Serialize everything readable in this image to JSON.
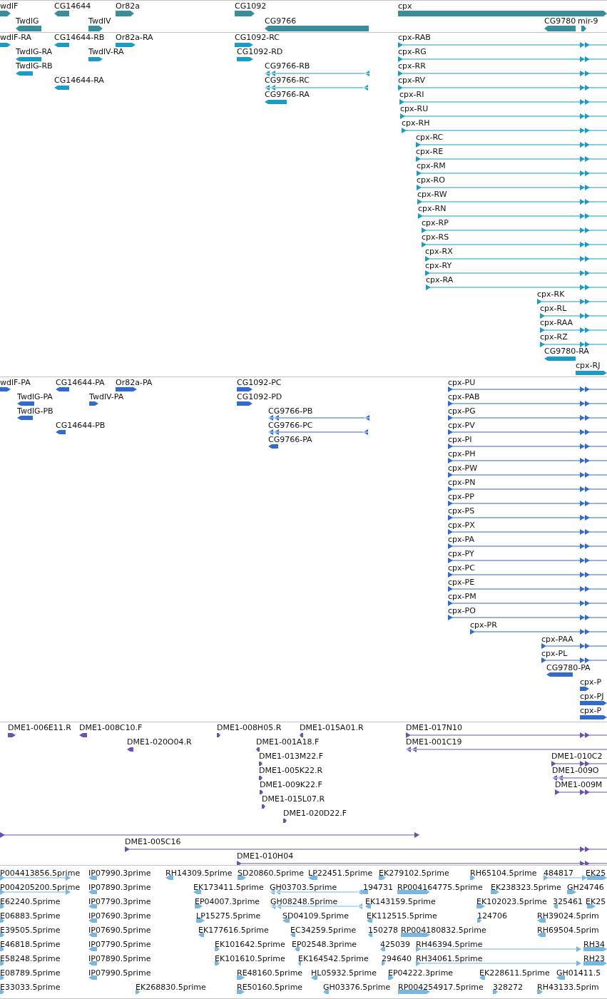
{
  "tracks": [
    {
      "kind": "gene",
      "color": "#3a8e9c",
      "features": [
        {
          "label": "wdlF",
          "forward": true
        },
        {
          "label": "CG14644",
          "forward": false
        },
        {
          "label": "Or82a",
          "forward": true
        },
        {
          "label": "CG1092",
          "forward": true
        },
        {
          "label": "cpx",
          "forward": true
        },
        {
          "label": "TwdlG",
          "forward": false
        },
        {
          "label": "TwdlV",
          "forward": true
        },
        {
          "label": "CG9766",
          "forward": false
        },
        {
          "label": "CG9780",
          "forward": false
        },
        {
          "label": "mir-9",
          "forward": true
        }
      ]
    },
    {
      "kind": "transcript",
      "color": "#1a9cc4",
      "features": [
        {
          "label": "wdlF-RA",
          "forward": true
        },
        {
          "label": "CG14644-RB",
          "forward": false
        },
        {
          "label": "Or82a-RA",
          "forward": true
        },
        {
          "label": "CG1092-RC",
          "forward": true
        },
        {
          "label": "cpx-RAB",
          "forward": true
        },
        {
          "label": "TwdlG-RA",
          "forward": false
        },
        {
          "label": "TwdlV-RA",
          "forward": true
        },
        {
          "label": "CG1092-RD",
          "forward": true
        },
        {
          "label": "cpx-RG",
          "forward": true
        },
        {
          "label": "TwdlG-RB",
          "forward": false
        },
        {
          "label": "CG9766-RB",
          "forward": false
        },
        {
          "label": "cpx-RR",
          "forward": true
        },
        {
          "label": "CG14644-RA",
          "forward": false
        },
        {
          "label": "CG9766-RC",
          "forward": false
        },
        {
          "label": "cpx-RV",
          "forward": true
        },
        {
          "label": "CG9766-RA",
          "forward": false
        },
        {
          "label": "cpx-RI",
          "forward": true
        },
        {
          "label": "cpx-RU",
          "forward": true
        },
        {
          "label": "cpx-RH",
          "forward": true
        },
        {
          "label": "cpx-RC",
          "forward": true
        },
        {
          "label": "cpx-RE",
          "forward": true
        },
        {
          "label": "cpx-RM",
          "forward": true
        },
        {
          "label": "cpx-RO",
          "forward": true
        },
        {
          "label": "cpx-RW",
          "forward": true
        },
        {
          "label": "cpx-RN",
          "forward": true
        },
        {
          "label": "cpx-RP",
          "forward": true
        },
        {
          "label": "cpx-RS",
          "forward": true
        },
        {
          "label": "cpx-RX",
          "forward": true
        },
        {
          "label": "cpx-RY",
          "forward": true
        },
        {
          "label": "cpx-RA",
          "forward": true
        },
        {
          "label": "cpx-RK",
          "forward": true
        },
        {
          "label": "cpx-RL",
          "forward": true
        },
        {
          "label": "cpx-RAA",
          "forward": true
        },
        {
          "label": "cpx-RZ",
          "forward": true
        },
        {
          "label": "CG9780-RA",
          "forward": false
        },
        {
          "label": "cpx-RJ",
          "forward": true
        }
      ]
    },
    {
      "kind": "protein",
      "color": "#2f6bd0",
      "features": [
        {
          "label": "wdlF-PA",
          "forward": true
        },
        {
          "label": "CG14644-PA",
          "forward": false
        },
        {
          "label": "Or82a-PA",
          "forward": true
        },
        {
          "label": "CG1092-PC",
          "forward": true
        },
        {
          "label": "cpx-PU",
          "forward": true
        },
        {
          "label": "TwdlG-PA",
          "forward": false
        },
        {
          "label": "TwdlV-PA",
          "forward": true
        },
        {
          "label": "CG1092-PD",
          "forward": true
        },
        {
          "label": "cpx-PAB",
          "forward": true
        },
        {
          "label": "TwdlG-PB",
          "forward": false
        },
        {
          "label": "CG9766-PB",
          "forward": false
        },
        {
          "label": "cpx-PG",
          "forward": true
        },
        {
          "label": "CG14644-PB",
          "forward": false
        },
        {
          "label": "CG9766-PC",
          "forward": false
        },
        {
          "label": "cpx-PV",
          "forward": true
        },
        {
          "label": "CG9766-PA",
          "forward": false
        },
        {
          "label": "cpx-PI",
          "forward": true
        },
        {
          "label": "cpx-PH",
          "forward": true
        },
        {
          "label": "cpx-PW",
          "forward": true
        },
        {
          "label": "cpx-PN",
          "forward": true
        },
        {
          "label": "cpx-PP",
          "forward": true
        },
        {
          "label": "cpx-PS",
          "forward": true
        },
        {
          "label": "cpx-PX",
          "forward": true
        },
        {
          "label": "cpx-PA",
          "forward": true
        },
        {
          "label": "cpx-PY",
          "forward": true
        },
        {
          "label": "cpx-PC",
          "forward": true
        },
        {
          "label": "cpx-PE",
          "forward": true
        },
        {
          "label": "cpx-PM",
          "forward": true
        },
        {
          "label": "cpx-PO",
          "forward": true
        },
        {
          "label": "cpx-PR",
          "forward": true
        },
        {
          "label": "cpx-PAA",
          "forward": true
        },
        {
          "label": "cpx-PL",
          "forward": true
        },
        {
          "label": "CG9780-PA",
          "forward": false
        },
        {
          "label": "cpx-P",
          "forward": true
        },
        {
          "label": "cpx-PJ",
          "forward": true
        },
        {
          "label": "cpx-P",
          "forward": true
        }
      ]
    },
    {
      "kind": "clone_end",
      "color": "#6b52b0",
      "features": [
        {
          "label": "DME1-006E11.R",
          "forward": true
        },
        {
          "label": "DME1-008C10.F",
          "forward": false
        },
        {
          "label": "DME1-008H05.R",
          "forward": true
        },
        {
          "label": "DME1-015A01.R",
          "forward": false
        },
        {
          "label": "DME1-017N10",
          "forward": true
        },
        {
          "label": "DME1-020O04.R",
          "forward": false
        },
        {
          "label": "DME1-001A18.F",
          "forward": false
        },
        {
          "label": "DME1-001C19",
          "forward": false
        },
        {
          "label": "DME1-013M22.F",
          "forward": true
        },
        {
          "label": "DME1-010C2",
          "forward": true
        },
        {
          "label": "DME1-005K22.R",
          "forward": true
        },
        {
          "label": "DME1-009O",
          "forward": false
        },
        {
          "label": "DME1-009K22.F",
          "forward": true
        },
        {
          "label": "DME1-009M",
          "forward": true
        },
        {
          "label": "DME1-015L07.R",
          "forward": true
        },
        {
          "label": "DME1-020D22.F",
          "forward": true
        },
        {
          "forward": true
        },
        {
          "label": "DME1-005C16",
          "forward": true
        },
        {
          "label": "DME1-010H04",
          "forward": true
        }
      ]
    },
    {
      "kind": "cdna",
      "color": "#7ab6de",
      "features": [
        {
          "label": "P004413856.5prime",
          "forward": true
        },
        {
          "label": "IP07990.3prime",
          "forward": false
        },
        {
          "label": "RH14309.5prime",
          "forward": false
        },
        {
          "label": "SD20860.5prime",
          "forward": true
        },
        {
          "label": "LP22451.5prime",
          "forward": false
        },
        {
          "label": "EK279102.5prime",
          "forward": true
        },
        {
          "label": "RH65104.5prime",
          "forward": true
        },
        {
          "label": "484817",
          "forward": true
        },
        {
          "label": "EK25",
          "forward": true
        },
        {
          "label": "P004205200.5prime",
          "forward": true
        },
        {
          "label": "IP07890.3prime",
          "forward": false
        },
        {
          "label": "EK173411.5prime",
          "forward": false
        },
        {
          "label": "GH03703.5prime",
          "forward": false
        },
        {
          "label": "194731",
          "forward": false
        },
        {
          "label": "RP004164775.5prime",
          "forward": true
        },
        {
          "label": "EK238323.5prime",
          "forward": true
        },
        {
          "label": "GH24746",
          "forward": true
        },
        {
          "label": "E62240.5prime",
          "forward": true
        },
        {
          "label": "IP07790.3prime",
          "forward": false
        },
        {
          "label": "EP04007.3prime",
          "forward": true
        },
        {
          "label": "GH08248.5prime",
          "forward": false
        },
        {
          "label": "EK143159.5prime",
          "forward": false
        },
        {
          "label": "EK102023.5prime",
          "forward": true
        },
        {
          "label": "325461",
          "forward": false
        },
        {
          "label": "EK25",
          "forward": true
        },
        {
          "label": "E06883.5prime",
          "forward": true
        },
        {
          "label": "IP07690.3prime",
          "forward": false
        },
        {
          "label": "LP15275.5prime",
          "forward": true
        },
        {
          "label": "SD04109.5prime",
          "forward": false
        },
        {
          "label": "EK112515.5prime",
          "forward": false
        },
        {
          "label": "124706",
          "forward": true
        },
        {
          "label": "RH39024.5prim",
          "forward": false
        },
        {
          "label": "E39505.5prime",
          "forward": true
        },
        {
          "label": "IP07690.5prime",
          "forward": false
        },
        {
          "label": "EK177616.5prime",
          "forward": false
        },
        {
          "label": "EC34259.5prime",
          "forward": false
        },
        {
          "label": "150278",
          "forward": false
        },
        {
          "label": "RP004180832.5prime",
          "forward": true
        },
        {
          "label": "RH69504.5prim",
          "forward": false
        },
        {
          "label": "E46818.5prime",
          "forward": true
        },
        {
          "label": "IP07790.5prime",
          "forward": false
        },
        {
          "label": "EK101642.5prime",
          "forward": true
        },
        {
          "label": "EP02548.3prime",
          "forward": false
        },
        {
          "label": "425039",
          "forward": false
        },
        {
          "label": "RH46394.5prime",
          "forward": true
        },
        {
          "label": "RH34",
          "forward": true
        },
        {
          "label": "E58248.5prime",
          "forward": true
        },
        {
          "label": "IP07890.5prime",
          "forward": false
        },
        {
          "label": "EK101610.5prime",
          "forward": true
        },
        {
          "label": "EK164542.5prime",
          "forward": false
        },
        {
          "label": "294640",
          "forward": true
        },
        {
          "label": "RH34061.5prime",
          "forward": true
        },
        {
          "label": "RH23",
          "forward": true
        },
        {
          "label": "E08789.5prime",
          "forward": true
        },
        {
          "label": "IP07990.5prime",
          "forward": false
        },
        {
          "label": "RE48160.5prime",
          "forward": true
        },
        {
          "label": "HL05932.5prime",
          "forward": false
        },
        {
          "label": "EP04222.3prime",
          "forward": true
        },
        {
          "label": "EK228611.5prime",
          "forward": false
        },
        {
          "label": "GH01411.5",
          "forward": false
        },
        {
          "label": "E33033.5prime",
          "forward": true
        },
        {
          "label": "EK268830.5prime",
          "forward": true
        },
        {
          "label": "RE50160.5prime",
          "forward": true
        },
        {
          "label": "GH03376.5prime",
          "forward": false
        },
        {
          "label": "RP004254917.5prime",
          "forward": true
        },
        {
          "label": "328272",
          "forward": true
        },
        {
          "label": "RH43133.5prim",
          "forward": true
        }
      ]
    }
  ]
}
